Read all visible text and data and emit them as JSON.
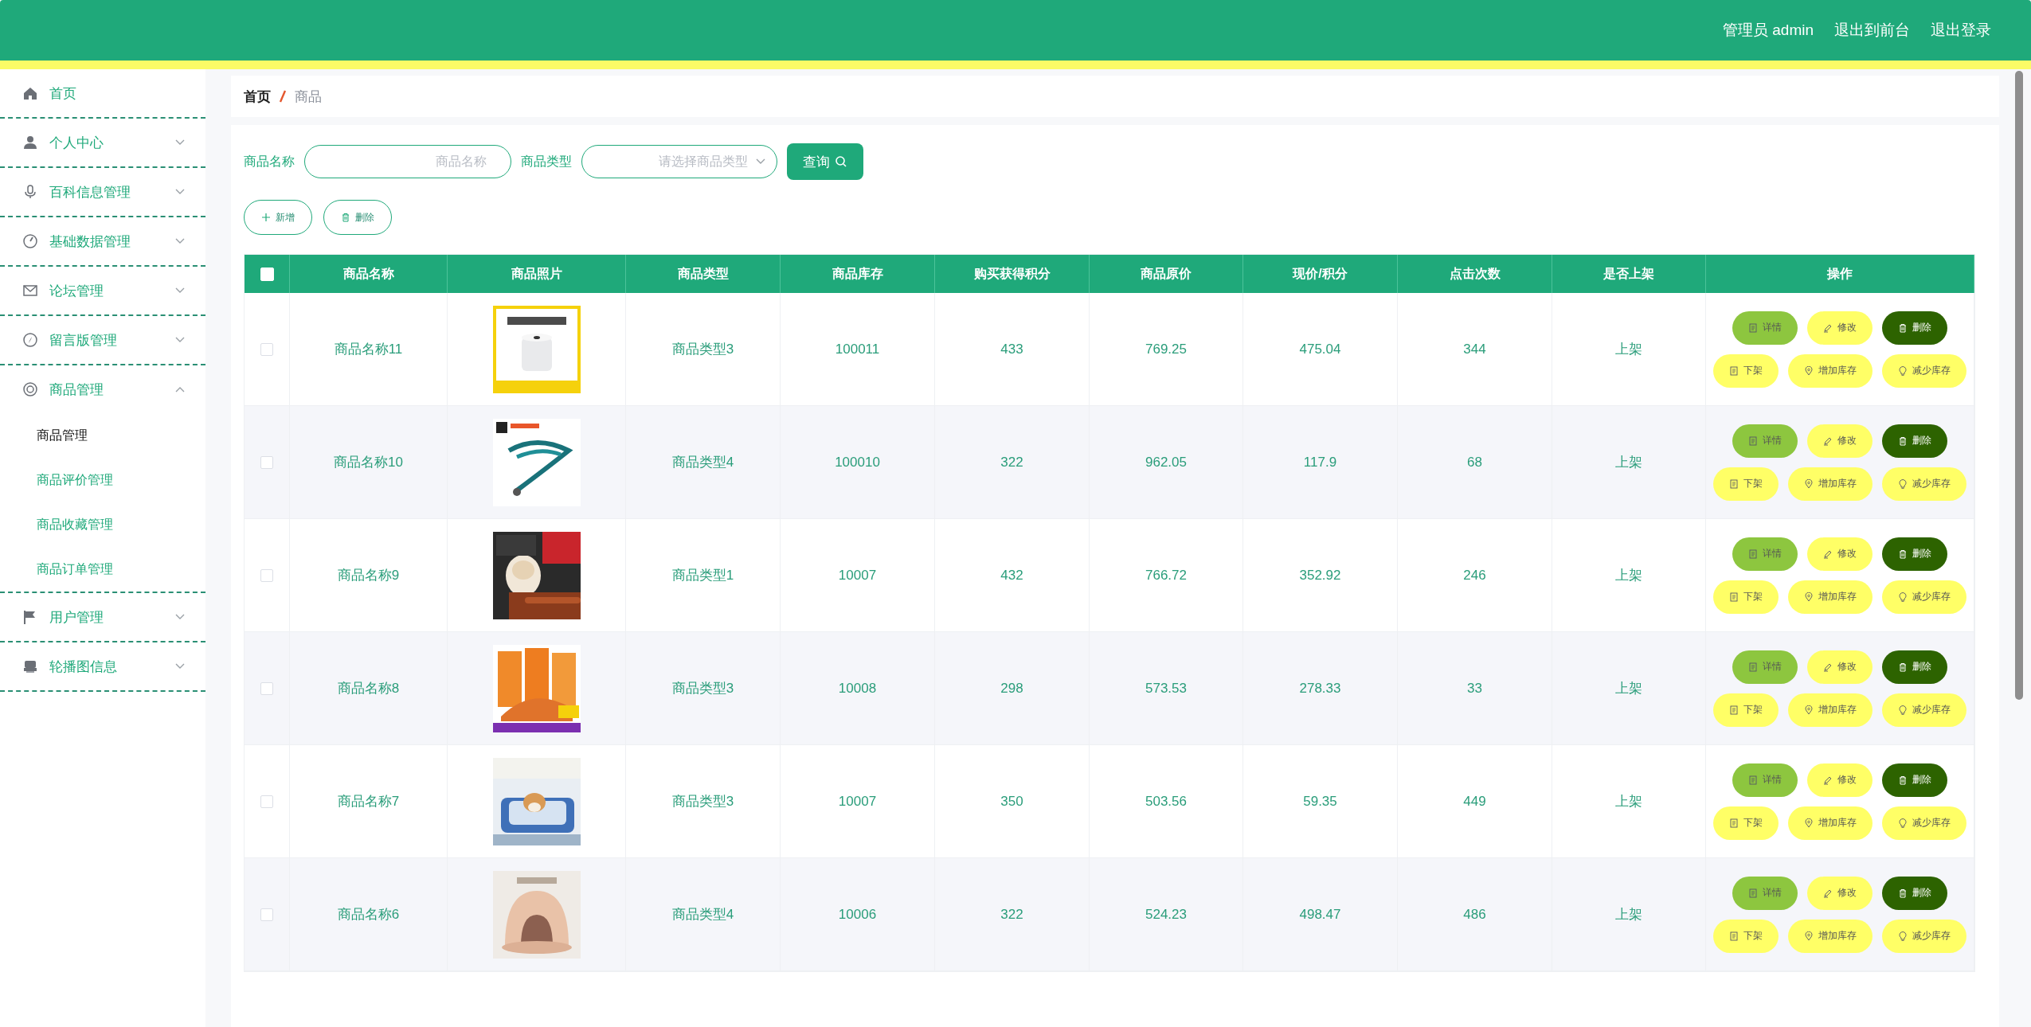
{
  "header": {
    "links": [
      "管理员 admin",
      "退出到前台",
      "退出登录"
    ]
  },
  "sidebar": {
    "items": [
      {
        "label": "首页",
        "kind": "link"
      },
      {
        "label": "个人中心",
        "kind": "group",
        "expanded": false
      },
      {
        "label": "百科信息管理",
        "kind": "group",
        "expanded": false
      },
      {
        "label": "基础数据管理",
        "kind": "group",
        "expanded": false
      },
      {
        "label": "论坛管理",
        "kind": "group",
        "expanded": false
      },
      {
        "label": "留言版管理",
        "kind": "group",
        "expanded": false
      },
      {
        "label": "商品管理",
        "kind": "group",
        "expanded": true,
        "children": [
          {
            "label": "商品管理",
            "selected": true
          },
          {
            "label": "商品评价管理",
            "selected": false
          },
          {
            "label": "商品收藏管理",
            "selected": false
          },
          {
            "label": "商品订单管理",
            "selected": false
          }
        ]
      },
      {
        "label": "用户管理",
        "kind": "group",
        "expanded": false
      },
      {
        "label": "轮播图信息",
        "kind": "group",
        "expanded": false
      }
    ]
  },
  "breadcrumb": [
    "首页",
    "商品"
  ],
  "filters": [
    {
      "label": "商品名称",
      "kind": "input",
      "placeholder": "商品名称"
    },
    {
      "label": "商品类型",
      "kind": "select",
      "placeholder": "请选择商品类型"
    }
  ],
  "search_button": "查询",
  "toolbar": [
    {
      "label": "新增",
      "kind": "add"
    },
    {
      "label": "删除",
      "kind": "delete"
    }
  ],
  "table": {
    "select_all": {
      "checked": false
    },
    "columns": [
      "商品名称",
      "商品照片",
      "商品类型",
      "商品库存",
      "购买获得积分",
      "商品原价",
      "现价/积分",
      "点击次数",
      "是否上架",
      "操作"
    ],
    "rows": [
      {
        "checked": false,
        "name": "商品名称11",
        "photo": {
          "kind": "picture"
        },
        "type": "商品类型3",
        "stock": "100011",
        "points": "433",
        "original_price": "769.25",
        "current_price": "475.04",
        "clicks": "344",
        "on_shelf": "上架",
        "actions": [
          [
            {
              "label": "详情",
              "kind": "detail"
            },
            {
              "label": "修改",
              "kind": "edit"
            },
            {
              "label": "删除",
              "kind": "delete"
            }
          ],
          [
            {
              "label": "下架",
              "kind": "toggle"
            },
            {
              "label": "增加库存",
              "kind": "add-stock"
            },
            {
              "label": "减少库存",
              "kind": "reduce-stock"
            }
          ]
        ]
      },
      {
        "checked": false,
        "name": "商品名称10",
        "photo": {
          "kind": "picture"
        },
        "type": "商品类型4",
        "stock": "100010",
        "points": "322",
        "original_price": "962.05",
        "current_price": "117.9",
        "clicks": "68",
        "on_shelf": "上架",
        "actions": [
          [
            {
              "label": "详情",
              "kind": "detail"
            },
            {
              "label": "修改",
              "kind": "edit"
            },
            {
              "label": "删除",
              "kind": "delete"
            }
          ],
          [
            {
              "label": "下架",
              "kind": "toggle"
            },
            {
              "label": "增加库存",
              "kind": "add-stock"
            },
            {
              "label": "减少库存",
              "kind": "reduce-stock"
            }
          ]
        ]
      },
      {
        "checked": false,
        "name": "商品名称9",
        "photo": {
          "kind": "picture"
        },
        "type": "商品类型1",
        "stock": "10007",
        "points": "432",
        "original_price": "766.72",
        "current_price": "352.92",
        "clicks": "246",
        "on_shelf": "上架",
        "actions": [
          [
            {
              "label": "详情",
              "kind": "detail"
            },
            {
              "label": "修改",
              "kind": "edit"
            },
            {
              "label": "删除",
              "kind": "delete"
            }
          ],
          [
            {
              "label": "下架",
              "kind": "toggle"
            },
            {
              "label": "增加库存",
              "kind": "add-stock"
            },
            {
              "label": "减少库存",
              "kind": "reduce-stock"
            }
          ]
        ]
      },
      {
        "checked": false,
        "name": "商品名称8",
        "photo": {
          "kind": "picture"
        },
        "type": "商品类型3",
        "stock": "10008",
        "points": "298",
        "original_price": "573.53",
        "current_price": "278.33",
        "clicks": "33",
        "on_shelf": "上架",
        "actions": [
          [
            {
              "label": "详情",
              "kind": "detail"
            },
            {
              "label": "修改",
              "kind": "edit"
            },
            {
              "label": "删除",
              "kind": "delete"
            }
          ],
          [
            {
              "label": "下架",
              "kind": "toggle"
            },
            {
              "label": "增加库存",
              "kind": "add-stock"
            },
            {
              "label": "减少库存",
              "kind": "reduce-stock"
            }
          ]
        ]
      },
      {
        "checked": false,
        "name": "商品名称7",
        "photo": {
          "kind": "picture"
        },
        "type": "商品类型3",
        "stock": "10007",
        "points": "350",
        "original_price": "503.56",
        "current_price": "59.35",
        "clicks": "449",
        "on_shelf": "上架",
        "actions": [
          [
            {
              "label": "详情",
              "kind": "detail"
            },
            {
              "label": "修改",
              "kind": "edit"
            },
            {
              "label": "删除",
              "kind": "delete"
            }
          ],
          [
            {
              "label": "下架",
              "kind": "toggle"
            },
            {
              "label": "增加库存",
              "kind": "add-stock"
            },
            {
              "label": "减少库存",
              "kind": "reduce-stock"
            }
          ]
        ]
      },
      {
        "checked": false,
        "name": "商品名称6",
        "photo": {
          "kind": "picture"
        },
        "type": "商品类型4",
        "stock": "10006",
        "points": "322",
        "original_price": "524.23",
        "current_price": "498.47",
        "clicks": "486",
        "on_shelf": "上架",
        "actions": [
          [
            {
              "label": "详情",
              "kind": "detail"
            },
            {
              "label": "修改",
              "kind": "edit"
            },
            {
              "label": "删除",
              "kind": "delete"
            }
          ],
          [
            {
              "label": "下架",
              "kind": "toggle"
            },
            {
              "label": "增加库存",
              "kind": "add-stock"
            },
            {
              "label": "减少库存",
              "kind": "reduce-stock"
            }
          ]
        ]
      }
    ]
  }
}
